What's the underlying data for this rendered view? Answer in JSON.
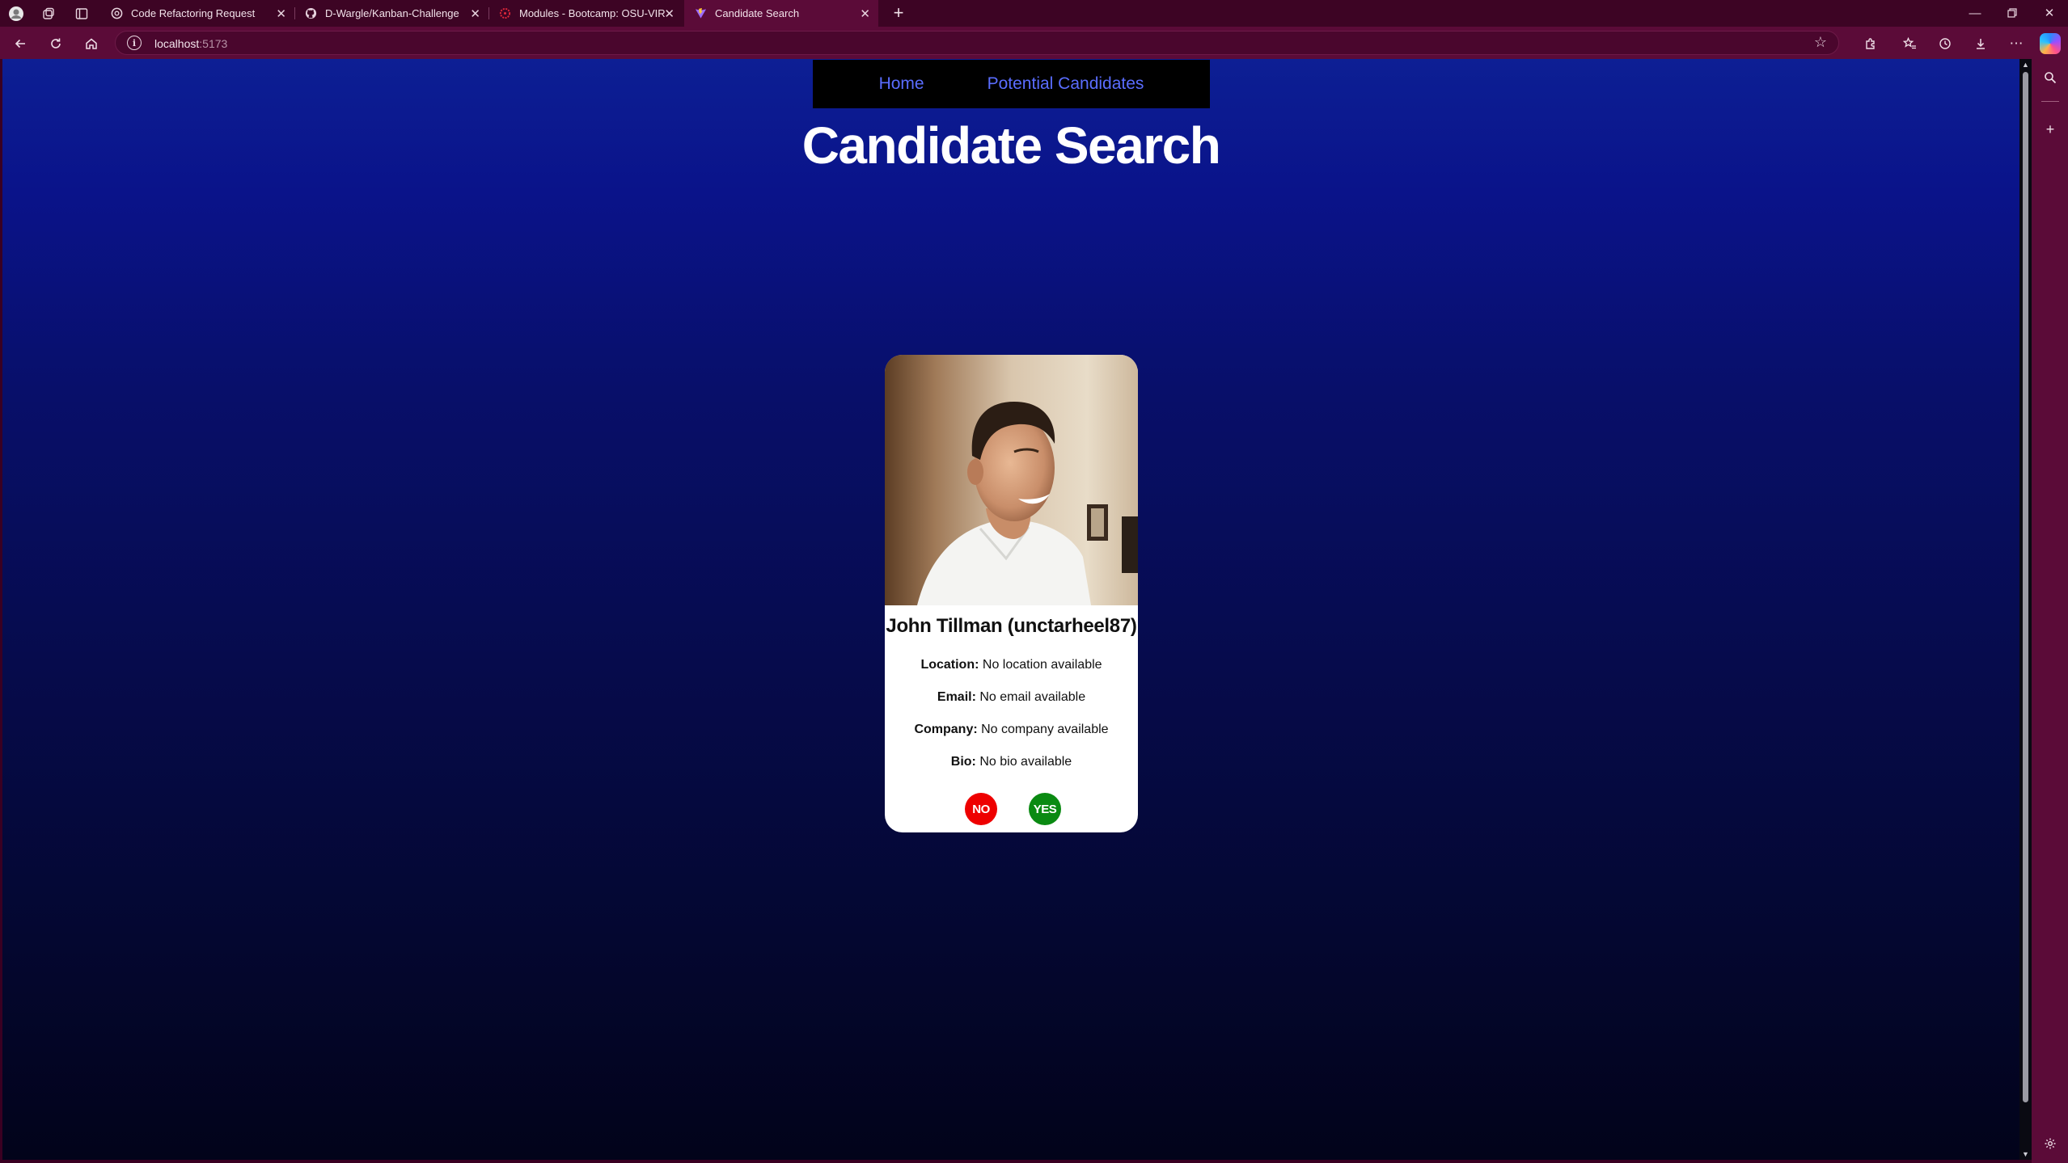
{
  "browser": {
    "tabs": [
      {
        "title": "Code Refactoring Request",
        "active": false,
        "icon": "openai-icon"
      },
      {
        "title": "D-Wargle/Kanban-Challenge",
        "active": false,
        "icon": "github-icon"
      },
      {
        "title": "Modules - Bootcamp: OSU-VIRT-",
        "active": false,
        "icon": "canvas-icon"
      },
      {
        "title": "Candidate Search",
        "active": true,
        "icon": "vite-icon"
      }
    ],
    "address": {
      "host": "localhost",
      "port": ":5173"
    }
  },
  "nav": {
    "home": "Home",
    "potential": "Potential Candidates"
  },
  "page": {
    "title": "Candidate Search"
  },
  "candidate": {
    "name": "John Tillman (unctarheel87)",
    "location_label": "Location:",
    "location": "No location available",
    "email_label": "Email:",
    "email": "No email available",
    "company_label": "Company:",
    "company": "No company available",
    "bio_label": "Bio:",
    "bio": "No bio available"
  },
  "actions": {
    "no": "NO",
    "yes": "YES",
    "no_color": "#ee0000",
    "yes_color": "#0a8a12"
  },
  "colors": {
    "nav_link": "#5a6dff",
    "browser_frame": "#5b0b38"
  }
}
